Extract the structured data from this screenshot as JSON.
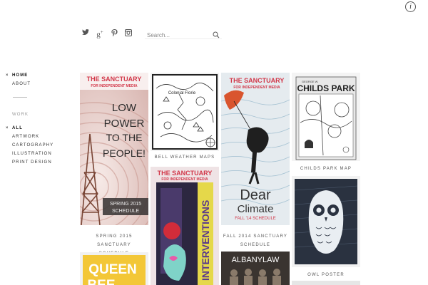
{
  "search": {
    "placeholder": "Search..."
  },
  "nav": {
    "home": "HOME",
    "about": "ABOUT",
    "work": "WORK",
    "all": "ALL",
    "artwork": "ARTWORK",
    "cartography": "CARTOGRAPHY",
    "illustration": "ILLUSTRATION",
    "print_design": "PRINT DESIGN"
  },
  "posters": {
    "spring": {
      "header": "THE SANCTUARY",
      "header2": "FOR INDEPENDENT MEDIA",
      "line1": "LOW",
      "line2": "POWER",
      "line3": "TO THE",
      "line4": "PEOPLE!",
      "sched1": "SPRING 2015",
      "sched2": "SCHEDULE",
      "caption1": "SPRING 2015 SANCTUARY",
      "caption2": "SCHEDULE"
    },
    "bell": {
      "map_title": "Colonial Florie",
      "caption": "BELL WEATHER MAPS"
    },
    "fall": {
      "header": "THE SANCTUARY",
      "header2": "FOR INDEPENDENT MEDIA",
      "line1": "Dear",
      "line2": "Climate",
      "line3": "FALL '14 SCHEDULE",
      "caption1": "FALL 2014 SANCTUARY",
      "caption2": "SCHEDULE"
    },
    "childs": {
      "title": "CHILDS PARK",
      "banner": "GEORGE W.",
      "caption": "CHILDS PARK MAP"
    },
    "interventions": {
      "header": "THE SANCTUARY",
      "header2": "FOR INDEPENDENT MEDIA",
      "word": "INTERVENTIONS"
    },
    "owl": {
      "caption": "OWL POSTER"
    },
    "queen": {
      "line1": "QUEEN",
      "line2": "BEE"
    },
    "albany": {
      "text": "ALBANYLAW"
    }
  }
}
